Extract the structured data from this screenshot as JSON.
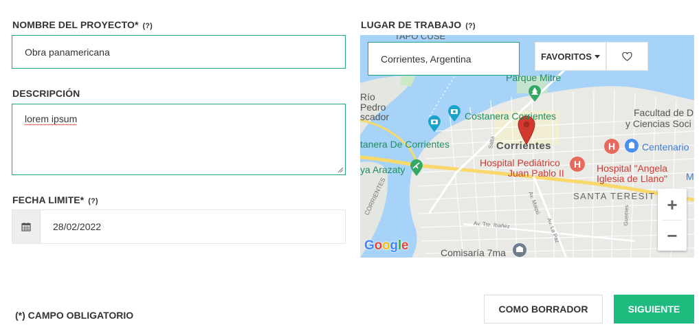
{
  "form": {
    "project_name": {
      "label": "NOMBRE DEL PROYECTO*",
      "help": "(?)",
      "value": "Obra panamericana"
    },
    "description": {
      "label": "DESCRIPCIÓN",
      "value": "lorem ipsum"
    },
    "deadline": {
      "label": "FECHA LIMITE*",
      "help": "(?)",
      "value": "28/02/2022"
    },
    "workplace": {
      "label": "LUGAR DE TRABAJO",
      "help": "(?)"
    }
  },
  "map": {
    "search_value": "Corrientes, Argentina",
    "favorites_label": "FAVORITOS",
    "zoom_in": "+",
    "zoom_out": "−",
    "google_letters": [
      "G",
      "o",
      "o",
      "g",
      "l",
      "e"
    ],
    "google_colors": [
      "#4285F4",
      "#EA4335",
      "#FBBC05",
      "#4285F4",
      "#34A853",
      "#EA4335"
    ],
    "labels": {
      "top_cut": "TAPO CUSE",
      "parque": "Parque Mitre",
      "rio": "Río",
      "pedro": "Pedro",
      "scador": "scador",
      "costanera": "Costanera Corrientes",
      "facultad": "Facultad de D",
      "ciencias": "y Ciencias Soci",
      "tanera": "tanera De Corrientes",
      "salta": "Salta",
      "corrientes": "Corrientes",
      "centenario": "Centenario",
      "hospital_ped": "Hospital Pediátrico",
      "juan_pablo": "Juan Pablo II",
      "hospital_angela": "Hospital \"Angela",
      "iglesia": "Iglesia de Llano\"",
      "arazaty": "ya Arazaty",
      "santa_teresita": "SANTA TERESIT",
      "maipu": "Av. Maipú",
      "ibanez": "Av. Tte. Ibañez",
      "paz": "Av. La Paz",
      "guemes": "Guemes",
      "corrientes_road": "CORRIENTES",
      "comisaria": "Comisaría 7ma",
      "edge_m": "M"
    }
  },
  "footer": {
    "required_note": "(*) CAMPO OBLIGATORIO",
    "draft_button": "COMO BORRADOR",
    "next_button": "SIGUIENTE"
  },
  "colors": {
    "accent": "#1fa67a",
    "primary_button": "#1fba7d",
    "map_water": "#a6d3f7",
    "marker": "#d33a2f"
  },
  "icons": {
    "calendar": "calendar-icon",
    "heart": "heart-icon",
    "caret": "caret-down-icon",
    "marker": "map-marker-icon"
  }
}
